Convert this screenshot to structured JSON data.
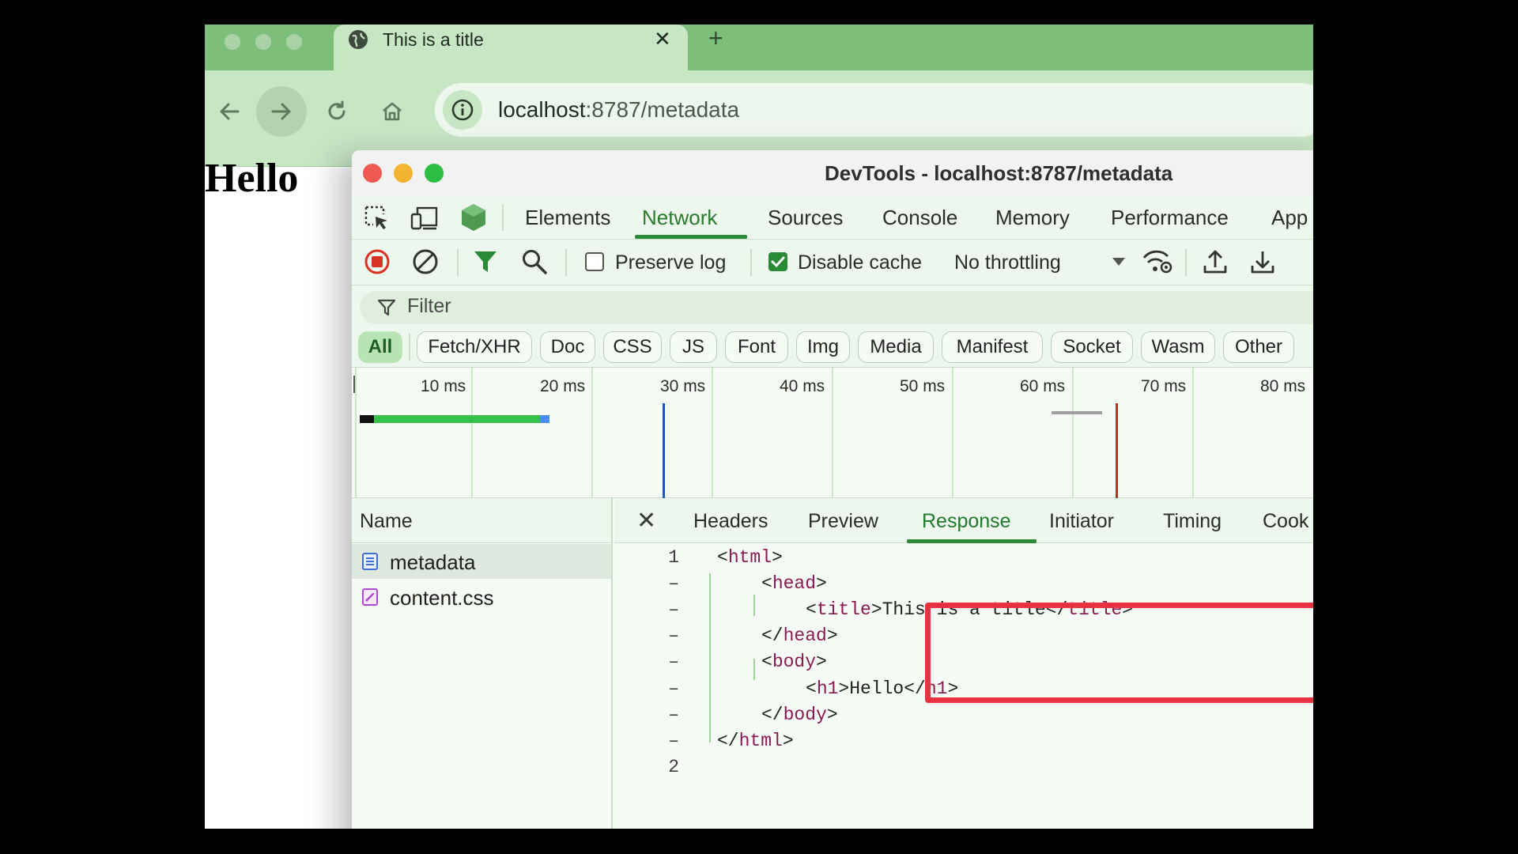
{
  "browser": {
    "tab_title": "This is a title",
    "tab_close": "✕",
    "new_tab": "+",
    "url_host": "localhost",
    "url_path": ":8787/metadata"
  },
  "page": {
    "heading": "Hello"
  },
  "devtools": {
    "window_title": "DevTools - localhost:8787/metadata",
    "tabs": [
      "Elements",
      "Network",
      "Sources",
      "Console",
      "Memory",
      "Performance",
      "App"
    ],
    "active_tab": "Network",
    "controls": {
      "preserve_log": "Preserve log",
      "preserve_log_checked": false,
      "disable_cache": "Disable cache",
      "disable_cache_checked": true,
      "throttling": "No throttling"
    },
    "filter_placeholder": "Filter",
    "type_filters": [
      "All",
      "Fetch/XHR",
      "Doc",
      "CSS",
      "JS",
      "Font",
      "Img",
      "Media",
      "Manifest",
      "Socket",
      "Wasm",
      "Other"
    ],
    "active_type_filter": "All",
    "timeline_ticks": [
      "10 ms",
      "20 ms",
      "30 ms",
      "40 ms",
      "50 ms",
      "60 ms",
      "70 ms",
      "80 ms"
    ],
    "requests_header": "Name",
    "requests": [
      {
        "name": "metadata",
        "type": "document"
      },
      {
        "name": "content.css",
        "type": "stylesheet"
      }
    ],
    "detail_tabs": [
      "Headers",
      "Preview",
      "Response",
      "Initiator",
      "Timing",
      "Cook"
    ],
    "active_detail_tab": "Response",
    "response_lines": [
      {
        "num": "1",
        "indent": 0,
        "pre": "<",
        "tag": "html",
        "mid": "",
        "tag2": "",
        "post": ">"
      },
      {
        "num": "–",
        "indent": 1,
        "pre": "<",
        "tag": "head",
        "mid": "",
        "tag2": "",
        "post": ">"
      },
      {
        "num": "–",
        "indent": 2,
        "pre": "<",
        "tag": "title",
        "mid": ">This is a title</",
        "tag2": "title",
        "post": ">"
      },
      {
        "num": "–",
        "indent": 1,
        "pre": "</",
        "tag": "head",
        "mid": "",
        "tag2": "",
        "post": ">"
      },
      {
        "num": "–",
        "indent": 1,
        "pre": "<",
        "tag": "body",
        "mid": "",
        "tag2": "",
        "post": ">"
      },
      {
        "num": "–",
        "indent": 2,
        "pre": "<",
        "tag": "h1",
        "mid": ">Hello</",
        "tag2": "h1",
        "post": ">"
      },
      {
        "num": "–",
        "indent": 1,
        "pre": "</",
        "tag": "body",
        "mid": "",
        "tag2": "",
        "post": ">"
      },
      {
        "num": "–",
        "indent": 0,
        "pre": "</",
        "tag": "html",
        "mid": "",
        "tag2": "",
        "post": ">"
      },
      {
        "num": "2",
        "indent": 0,
        "pre": "",
        "tag": "",
        "mid": "",
        "tag2": "",
        "post": ""
      }
    ]
  },
  "colors": {
    "browser_accent": "#7dbe7a",
    "devtools_active": "#2a8a36",
    "highlight_box": "#e8323f",
    "tag_color": "#8a1a52"
  }
}
